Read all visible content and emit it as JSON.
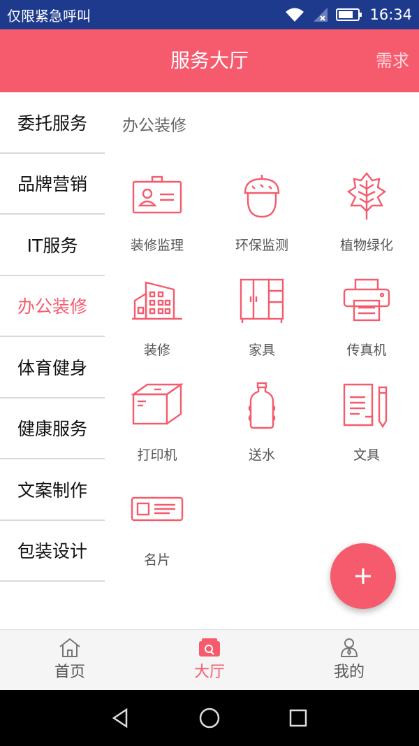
{
  "status_bar": {
    "carrier": "仅限紧急呼叫",
    "time": "16:34"
  },
  "header": {
    "title": "服务大厅",
    "action": "需求"
  },
  "sidebar": {
    "items": [
      {
        "label": "委托服务"
      },
      {
        "label": "品牌营销"
      },
      {
        "label": "IT服务"
      },
      {
        "label": "办公装修",
        "active": true
      },
      {
        "label": "体育健身"
      },
      {
        "label": "健康服务"
      },
      {
        "label": "文案制作"
      },
      {
        "label": "包装设计"
      }
    ]
  },
  "content": {
    "section_title": "办公装修",
    "items": [
      {
        "label": "装修监理",
        "icon": "id-card-icon"
      },
      {
        "label": "环保监测",
        "icon": "acorn-icon"
      },
      {
        "label": "植物绿化",
        "icon": "leaf-icon"
      },
      {
        "label": "装修",
        "icon": "building-icon"
      },
      {
        "label": "家具",
        "icon": "cabinet-icon"
      },
      {
        "label": "传真机",
        "icon": "printer-icon"
      },
      {
        "label": "打印机",
        "icon": "box-icon"
      },
      {
        "label": "送水",
        "icon": "water-bottle-icon"
      },
      {
        "label": "文具",
        "icon": "document-pen-icon"
      },
      {
        "label": "名片",
        "icon": "business-card-icon"
      }
    ]
  },
  "fab": {
    "icon": "plus-icon"
  },
  "bottom_nav": {
    "items": [
      {
        "label": "首页",
        "icon": "home-icon"
      },
      {
        "label": "大厅",
        "icon": "shop-icon",
        "active": true
      },
      {
        "label": "我的",
        "icon": "user-icon"
      }
    ]
  },
  "colors": {
    "accent": "#f55b6d",
    "status_bar": "#1d3a8c"
  }
}
